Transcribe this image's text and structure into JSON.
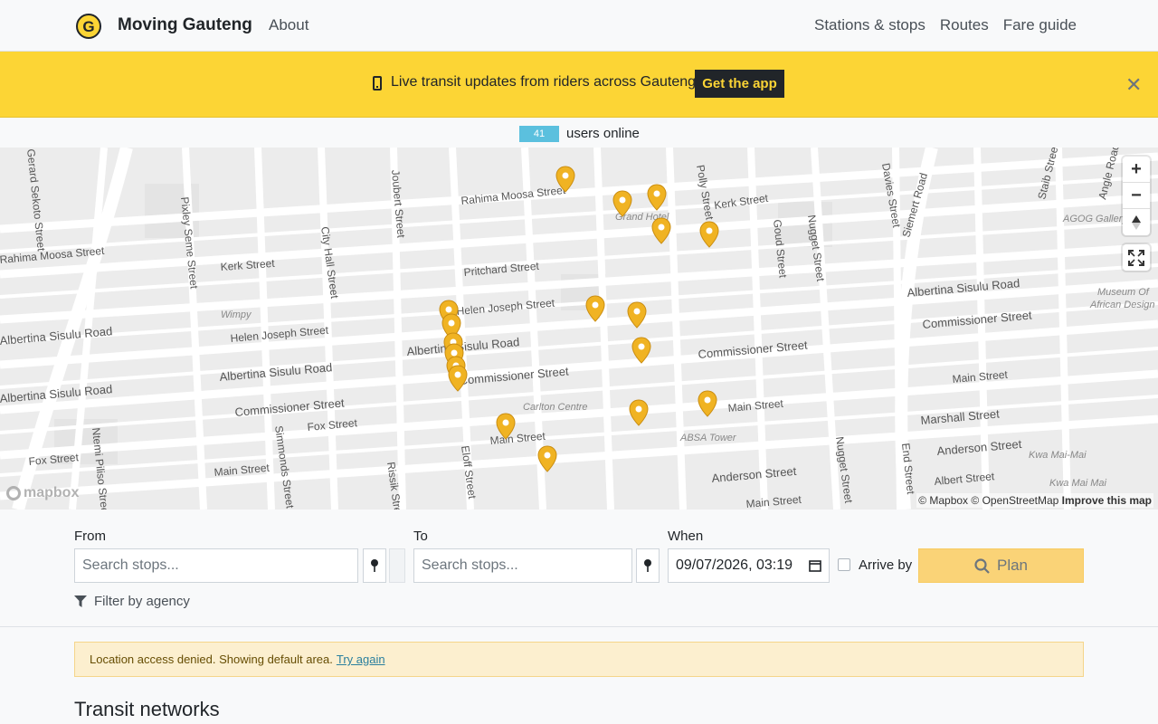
{
  "navbar": {
    "brand": "Moving Gauteng",
    "about": "About",
    "links": [
      "Stations & stops",
      "Routes",
      "Fare guide"
    ]
  },
  "banner": {
    "text": "Live transit updates from riders across Gauteng.",
    "button": "Get the app",
    "bg_color": "#fcd535"
  },
  "users_online": {
    "count": "41",
    "label": "users online"
  },
  "map": {
    "streets": [
      "Rahima Moosa Street",
      "Kerk Street",
      "Polly Street",
      "Davies Street",
      "Siemert Road",
      "Staib Street",
      "Angle Road",
      "Grand Hotel",
      "AGOG Gallery",
      "Goud Street",
      "Nugget Street",
      "Pritchard Street",
      "Joubert Street",
      "City Hall Street",
      "Pixley Seme Street",
      "Gerard Sekoto Street",
      "Rahima Moosa Street",
      "Kerk Street",
      "Helen Joseph Street",
      "Wimpy",
      "Helen Joseph Street",
      "Albertina Sisulu Road",
      "Albertina Sisulu Road",
      "Albertina Sisulu Road",
      "Commissioner Street",
      "Commissioner Street",
      "Museum Of",
      "African Design",
      "Albertina Sisulu Road",
      "Commissioner Street",
      "Commissioner Street",
      "Carlton Centre",
      "Main Street",
      "Main Street",
      "Main Street",
      "Fox Street",
      "Fox Street",
      "Main Street",
      "ABSA Tower",
      "Marshall Street",
      "Anderson Street",
      "Anderson Street",
      "Kwa Mai-Mai",
      "Albert Street",
      "Kwa Mai Mai",
      "Eloff Street",
      "Rissik Street",
      "Simmonds Street",
      "Ntemi Piliso Street",
      "Nugget Street",
      "End Street",
      "Main Street",
      "Albertina Sisulu Road"
    ],
    "attribution_mapbox": "© Mapbox",
    "attribution_osm": "© OpenStreetMap",
    "attribution_improve": "Improve this map",
    "logo": "mapbox",
    "pin_color": "#f0b323"
  },
  "form": {
    "from_label": "From",
    "from_placeholder": "Search stops...",
    "to_label": "To",
    "to_placeholder": "Search stops...",
    "when_label": "When",
    "when_value": "09/07/2026, 03:19",
    "arrive_by": "Arrive by",
    "plan": "Plan",
    "filter": "Filter by agency"
  },
  "alert": {
    "text": "Location access denied. Showing default area.",
    "link": "Try again"
  },
  "section_title": "Transit networks"
}
